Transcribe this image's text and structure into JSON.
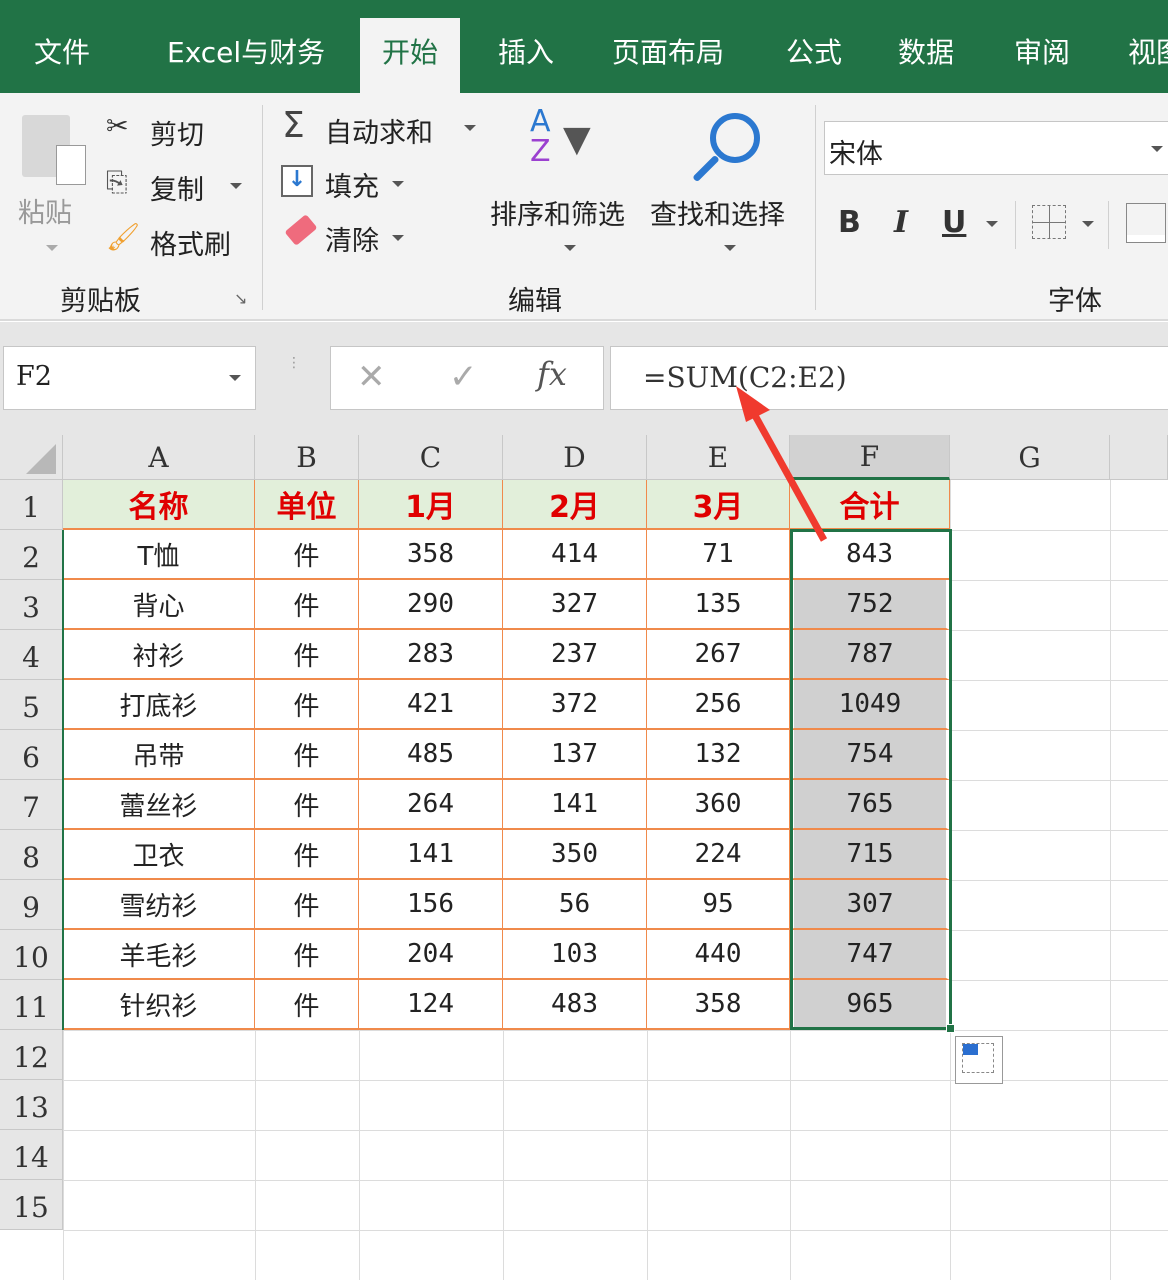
{
  "tabs": [
    "文件",
    "Excel与财务",
    "开始",
    "插入",
    "页面布局",
    "公式",
    "数据",
    "审阅",
    "视图"
  ],
  "active_tab": 2,
  "ribbon": {
    "paste": "粘贴",
    "cut": "剪切",
    "copy": "复制",
    "format_painter": "格式刷",
    "clipboard_group": "剪贴板",
    "autosum": "自动求和",
    "fill": "填充",
    "clear": "清除",
    "sort_filter": "排序和筛选",
    "find_select": "查找和选择",
    "editing_group": "编辑",
    "font_name": "宋体",
    "bold": "B",
    "italic": "I",
    "underline": "U",
    "font_group": "字体"
  },
  "formula_bar": {
    "name_box": "F2",
    "formula": "=SUM(C2:E2)",
    "fx": "fx"
  },
  "columns": [
    "A",
    "B",
    "C",
    "D",
    "E",
    "F",
    "G"
  ],
  "rows": [
    "1",
    "2",
    "3",
    "4",
    "5",
    "6",
    "7",
    "8",
    "9",
    "10",
    "11",
    "12",
    "13",
    "14",
    "15"
  ],
  "table": {
    "headers": [
      "名称",
      "单位",
      "1月",
      "2月",
      "3月",
      "合计"
    ],
    "data": [
      [
        "T恤",
        "件",
        "358",
        "414",
        "71",
        "843"
      ],
      [
        "背心",
        "件",
        "290",
        "327",
        "135",
        "752"
      ],
      [
        "衬衫",
        "件",
        "283",
        "237",
        "267",
        "787"
      ],
      [
        "打底衫",
        "件",
        "421",
        "372",
        "256",
        "1049"
      ],
      [
        "吊带",
        "件",
        "485",
        "137",
        "132",
        "754"
      ],
      [
        "蕾丝衫",
        "件",
        "264",
        "141",
        "360",
        "765"
      ],
      [
        "卫衣",
        "件",
        "141",
        "350",
        "224",
        "715"
      ],
      [
        "雪纺衫",
        "件",
        "156",
        "56",
        "95",
        "307"
      ],
      [
        "羊毛衫",
        "件",
        "204",
        "103",
        "440",
        "747"
      ],
      [
        "针织衫",
        "件",
        "124",
        "483",
        "358",
        "965"
      ]
    ]
  },
  "colors": {
    "accent": "#217346",
    "header_text": "#e00000",
    "header_fill": "#e2efda",
    "border": "#f08a4b",
    "selected_fill": "#d0d0d0",
    "arrow": "#f03a2e"
  }
}
